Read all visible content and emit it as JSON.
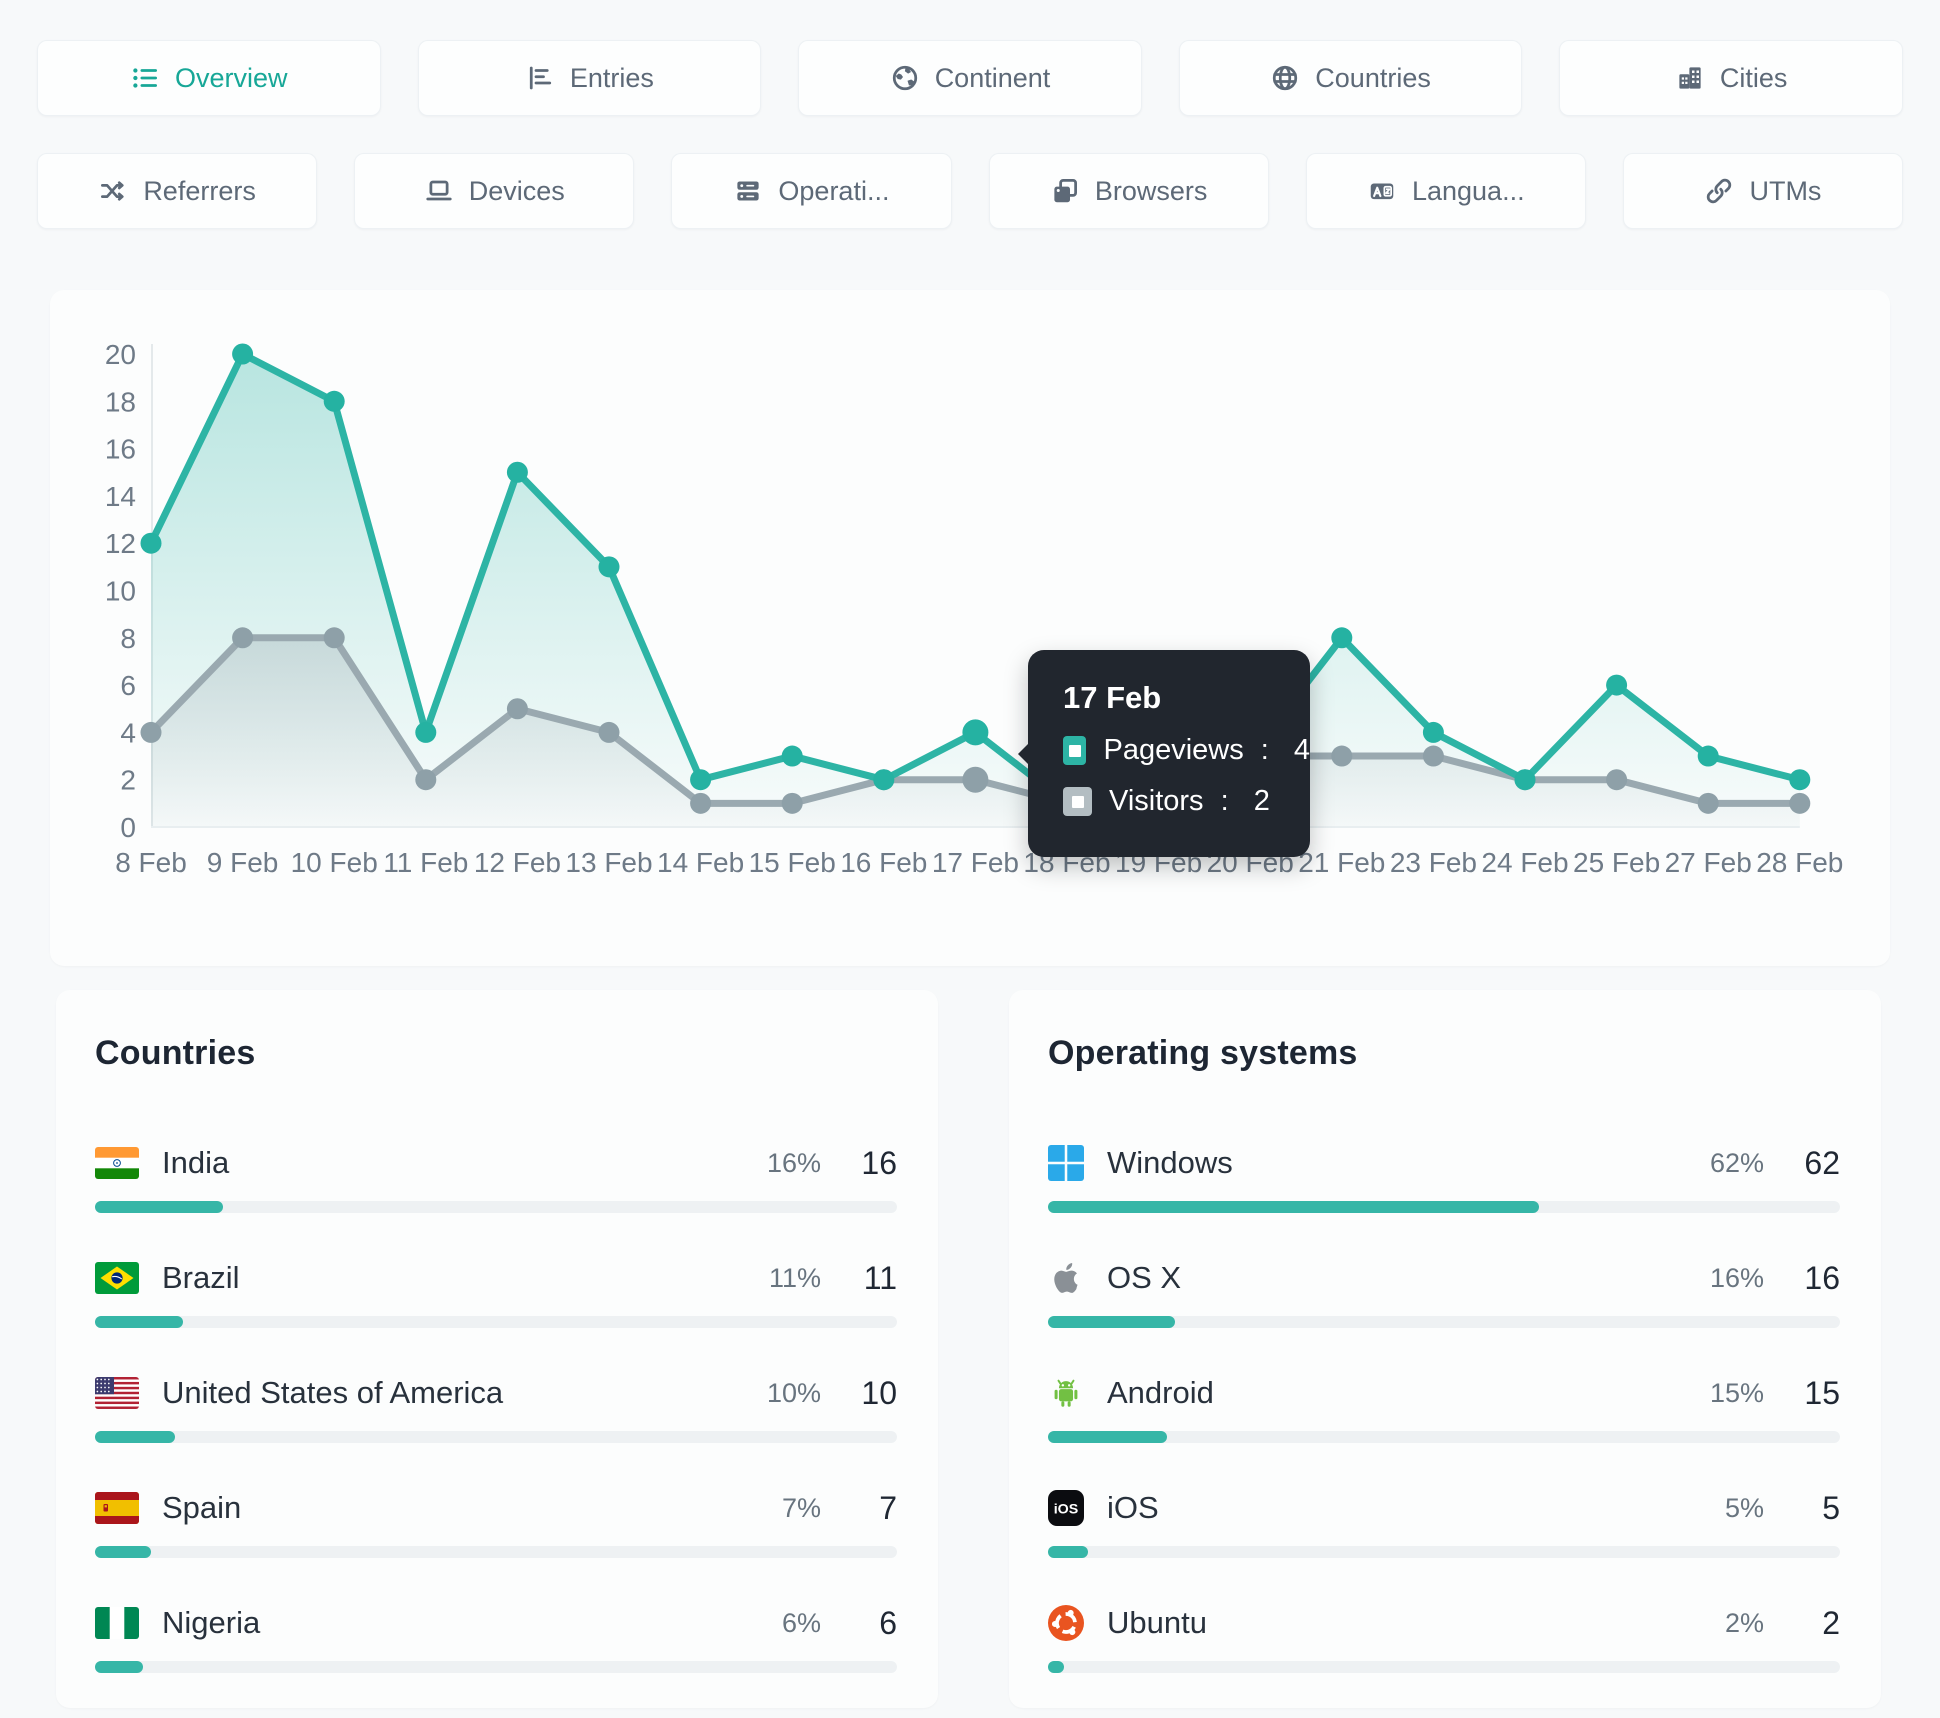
{
  "tabs_row1": [
    {
      "label": "Overview",
      "icon": "list-icon",
      "active": true
    },
    {
      "label": "Entries",
      "icon": "bar-chart-icon",
      "active": false
    },
    {
      "label": "Continent",
      "icon": "earth-icon",
      "active": false
    },
    {
      "label": "Countries",
      "icon": "globe-icon",
      "active": false
    },
    {
      "label": "Cities",
      "icon": "buildings-icon",
      "active": false
    }
  ],
  "tabs_row2": [
    {
      "label": "Referrers",
      "icon": "shuffle-icon",
      "active": false
    },
    {
      "label": "Devices",
      "icon": "laptop-icon",
      "active": false
    },
    {
      "label": "Operati...",
      "icon": "server-icon",
      "active": false
    },
    {
      "label": "Browsers",
      "icon": "browser-icon",
      "active": false
    },
    {
      "label": "Langua...",
      "icon": "translate-icon",
      "active": false
    },
    {
      "label": "UTMs",
      "icon": "link-icon",
      "active": false
    }
  ],
  "chart_data": {
    "type": "line",
    "x": [
      "8 Feb",
      "9 Feb",
      "10 Feb",
      "11 Feb",
      "12 Feb",
      "13 Feb",
      "14 Feb",
      "15 Feb",
      "16 Feb",
      "17 Feb",
      "18 Feb",
      "19 Feb",
      "20 Feb",
      "21 Feb",
      "23 Feb",
      "24 Feb",
      "25 Feb",
      "27 Feb",
      "28 Feb"
    ],
    "series": [
      {
        "name": "Pageviews",
        "color": "#2db4a5",
        "values": [
          12,
          20,
          18,
          4,
          15,
          11,
          2,
          3,
          2,
          4,
          1,
          1,
          3,
          8,
          4,
          2,
          6,
          3,
          2
        ]
      },
      {
        "name": "Visitors",
        "color": "#9aa9b0",
        "values": [
          4,
          8,
          8,
          2,
          5,
          4,
          1,
          1,
          2,
          2,
          1,
          1,
          3,
          3,
          3,
          2,
          2,
          1,
          1
        ]
      }
    ],
    "ylim": [
      0,
      20
    ],
    "ytick_step": 2,
    "grid": false,
    "legend_position": "tooltip-only",
    "hover_index": 9
  },
  "tooltip": {
    "title": "17 Feb",
    "rows": [
      {
        "label": "Pageviews",
        "value": "4",
        "color": "#2db4a5"
      },
      {
        "label": "Visitors",
        "value": "2",
        "color": "#b3bdc2"
      }
    ]
  },
  "panels": {
    "countries": {
      "title": "Countries",
      "rows": [
        {
          "name": "India",
          "icon": "india-flag",
          "pct": "16%",
          "count": "16",
          "pct_value": 16
        },
        {
          "name": "Brazil",
          "icon": "brazil-flag",
          "pct": "11%",
          "count": "11",
          "pct_value": 11
        },
        {
          "name": "United States of America",
          "icon": "usa-flag",
          "pct": "10%",
          "count": "10",
          "pct_value": 10
        },
        {
          "name": "Spain",
          "icon": "spain-flag",
          "pct": "7%",
          "count": "7",
          "pct_value": 7
        },
        {
          "name": "Nigeria",
          "icon": "nigeria-flag",
          "pct": "6%",
          "count": "6",
          "pct_value": 6
        }
      ]
    },
    "operating_systems": {
      "title": "Operating systems",
      "rows": [
        {
          "name": "Windows",
          "icon": "windows-icon",
          "pct": "62%",
          "count": "62",
          "pct_value": 62
        },
        {
          "name": "OS X",
          "icon": "apple-icon",
          "pct": "16%",
          "count": "16",
          "pct_value": 16
        },
        {
          "name": "Android",
          "icon": "android-icon",
          "pct": "15%",
          "count": "15",
          "pct_value": 15
        },
        {
          "name": "iOS",
          "icon": "ios-icon",
          "pct": "5%",
          "count": "5",
          "pct_value": 5
        },
        {
          "name": "Ubuntu",
          "icon": "ubuntu-icon",
          "pct": "2%",
          "count": "2",
          "pct_value": 2
        }
      ]
    }
  },
  "colors": {
    "accent": "#17a797",
    "pageviews_line": "#2db4a5",
    "visitors_line": "#9aa9b0",
    "bar_fill": "#36b6a7",
    "bar_track": "#eef1f3",
    "tooltip_bg": "#21262e",
    "tick_text": "#6e7a87"
  }
}
